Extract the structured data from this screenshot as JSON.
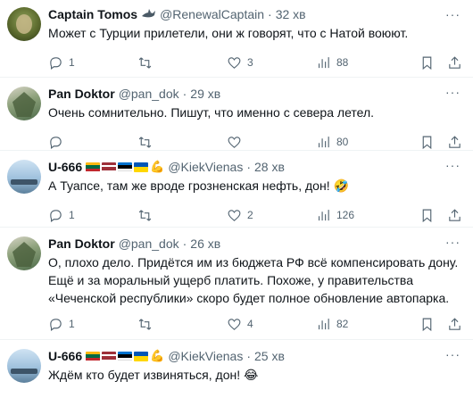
{
  "tweets": [
    {
      "name": "Captain Tomos",
      "handle": "@RenewalCaptain",
      "time": "32 хв",
      "text": "Может с Турции прилетели, они ж говорят, что с Натой воюют.",
      "replies": "1",
      "retweets": "",
      "likes": "3",
      "views": "88",
      "badge_icon": "shark-icon"
    },
    {
      "name": "Pan Doktor",
      "handle": "@pan_dok",
      "time": "29 хв",
      "text": "Очень сомнительно. Пишут, что именно с севера летел.",
      "replies": "",
      "retweets": "",
      "likes": "",
      "views": "80"
    },
    {
      "name": "U-666",
      "handle": "@KiekVienas",
      "time": "28 хв",
      "text": "А Туапсе, там же вроде грозненская нефть, дон! 🤣",
      "replies": "1",
      "retweets": "",
      "likes": "2",
      "views": "126"
    },
    {
      "name": "Pan Doktor",
      "handle": "@pan_dok",
      "time": "26 хв",
      "text": "О, плохо дело. Придётся им из бюджета РФ всё компенсировать дону.\nЕщё и за моральный ущерб платить. Похоже, у правительства\n«Чеченской республики» скоро будет полное обновление автопарка.",
      "replies": "1",
      "retweets": "",
      "likes": "4",
      "views": "82"
    },
    {
      "name": "U-666",
      "handle": "@KiekVienas",
      "time": "25 хв",
      "text": "Ждём кто будет извиняться, дон! 😂"
    }
  ],
  "separator": "·",
  "more_label": "···",
  "icons": {
    "reply": "reply-icon",
    "retweet": "retweet-icon",
    "like": "heart-icon",
    "views": "views-icon",
    "bookmark": "bookmark-icon",
    "share": "share-icon",
    "biceps": "flexed-biceps-icon"
  },
  "flags": [
    "lithuania",
    "latvia",
    "estonia",
    "ukraine"
  ],
  "colors": {
    "text": "#0f1419",
    "secondary": "#536471",
    "divider": "#eff3f4"
  }
}
